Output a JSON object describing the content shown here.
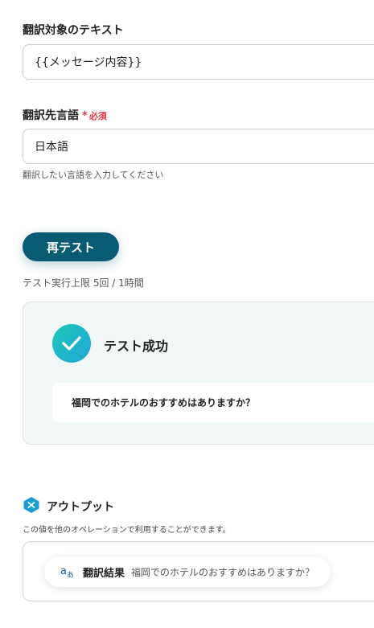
{
  "source_text": {
    "label": "翻訳対象のテキスト",
    "value": "{{メッセージ内容}}"
  },
  "target_language": {
    "label": "翻訳先言語",
    "required_mark": "*",
    "required_text": "必須",
    "value": "日本語",
    "hint": "翻訳したい言語を入力してください"
  },
  "test": {
    "retest_label": "再テスト",
    "limit_text": "テスト実行上限 5回 / 1時間",
    "success_title": "テスト成功",
    "result_text": "福岡でのホテルのおすすめはありますか？"
  },
  "output": {
    "title": "アウトプット",
    "description": "この値を他のオペレーションで利用することができます。",
    "chip_label": "翻訳結果",
    "chip_value": "福岡でのホテルのおすすめはありますか？"
  },
  "colors": {
    "primary": "#0a5a73",
    "required": "#e0394a",
    "success_gradient_start": "#1fc7b6",
    "success_gradient_end": "#1ea6d8",
    "card_bg": "#f1f8f7"
  }
}
